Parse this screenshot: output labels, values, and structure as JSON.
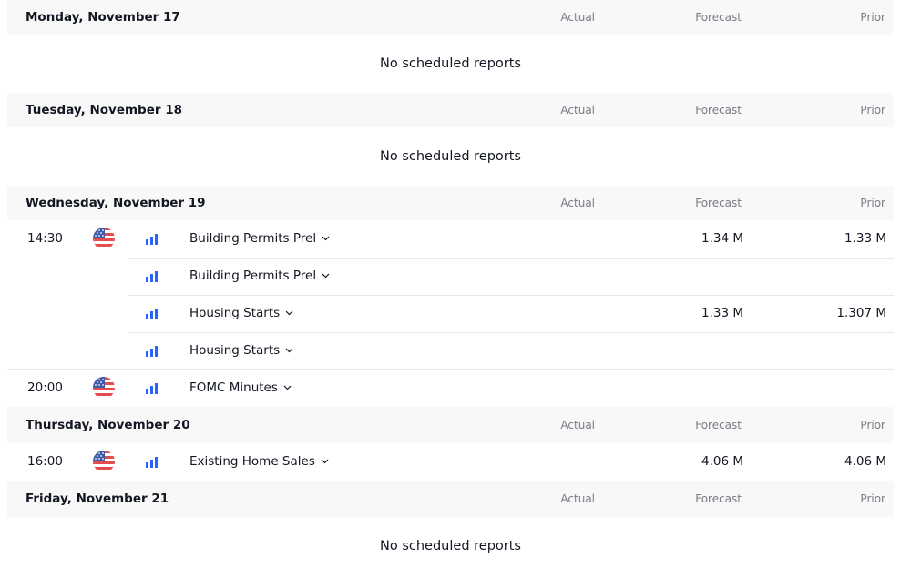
{
  "columns": {
    "actual": "Actual",
    "forecast": "Forecast",
    "prior": "Prior"
  },
  "days": [
    {
      "title": "Monday, November 17",
      "empty": "No scheduled reports"
    },
    {
      "title": "Tuesday, November 18",
      "empty": "No scheduled reports"
    },
    {
      "title": "Wednesday, November 19",
      "events": [
        {
          "time": "14:30",
          "name": "Building Permits Prel",
          "forecast": "1.34 M",
          "prior": "1.33 M"
        },
        {
          "time": "",
          "name": "Building Permits Prel",
          "forecast": "",
          "prior": ""
        },
        {
          "time": "",
          "name": "Housing Starts",
          "forecast": "1.33 M",
          "prior": "1.307 M"
        },
        {
          "time": "",
          "name": "Housing Starts",
          "forecast": "",
          "prior": ""
        },
        {
          "time": "20:00",
          "name": "FOMC Minutes",
          "forecast": "",
          "prior": ""
        }
      ]
    },
    {
      "title": "Thursday, November 20",
      "events": [
        {
          "time": "16:00",
          "name": "Existing Home Sales",
          "forecast": "4.06 M",
          "prior": "4.06 M"
        }
      ]
    },
    {
      "title": "Friday, November 21",
      "empty": "No scheduled reports"
    }
  ],
  "icons": {
    "flag": "us-flag-icon",
    "importance": "importance-bars-icon",
    "expand": "chevron-down-icon"
  },
  "colors": {
    "importance_blue": "#2962ff",
    "header_bg": "#f8f8f8",
    "muted_text": "#787b86"
  }
}
